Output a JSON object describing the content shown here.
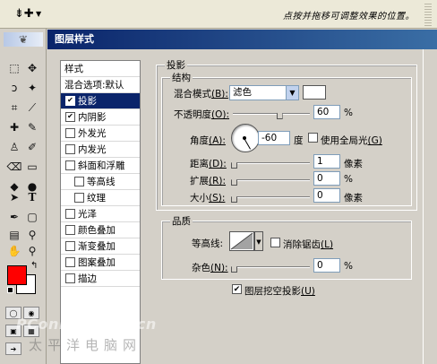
{
  "options_bar": {
    "hint": "点按并拖移可调整效果的位置。",
    "tool_icon": "move-tool-icon",
    "preset_arrow": "▼"
  },
  "dialog": {
    "title": "图层样式"
  },
  "style_list": {
    "header": "样式",
    "blend_default": "混合选项:默认",
    "items": [
      {
        "label": "投影",
        "checked": true,
        "selected": true
      },
      {
        "label": "内阴影",
        "checked": true,
        "selected": false
      },
      {
        "label": "外发光",
        "checked": false,
        "selected": false
      },
      {
        "label": "内发光",
        "checked": false,
        "selected": false
      },
      {
        "label": "斜面和浮雕",
        "checked": false,
        "selected": false
      },
      {
        "label": "等高线",
        "checked": false,
        "selected": false
      },
      {
        "label": "纹理",
        "checked": false,
        "selected": false
      },
      {
        "label": "光泽",
        "checked": false,
        "selected": false
      },
      {
        "label": "颜色叠加",
        "checked": false,
        "selected": false
      },
      {
        "label": "渐变叠加",
        "checked": false,
        "selected": false
      },
      {
        "label": "图案叠加",
        "checked": false,
        "selected": false
      },
      {
        "label": "描边",
        "checked": false,
        "selected": false
      }
    ]
  },
  "drop_shadow": {
    "section_title": "投影",
    "structure": {
      "title": "结构",
      "blend_mode_label": "混合模式",
      "blend_mode_key": "(B):",
      "blend_mode_value": "滤色",
      "shadow_color": "#ffffff",
      "opacity_label": "不透明度",
      "opacity_key": "(O):",
      "opacity_value": "60",
      "opacity_unit": "%",
      "opacity_level": 0.6,
      "angle_label": "角度",
      "angle_key": "(A):",
      "angle_value": "-60",
      "angle_unit": "度",
      "global_light_label": "使用全局光",
      "global_light_key": "(G)",
      "global_light_checked": false,
      "distance_label": "距离",
      "distance_key": "(D):",
      "distance_value": "1",
      "distance_unit": "像素",
      "spread_label": "扩展",
      "spread_key": "(R):",
      "spread_value": "0",
      "spread_unit": "%",
      "size_label": "大小",
      "size_key": "(S):",
      "size_value": "0",
      "size_unit": "像素"
    },
    "quality": {
      "title": "品质",
      "contour_label": "等高线:",
      "antialias_label": "消除锯齿",
      "antialias_key": "(L)",
      "antialias_checked": false,
      "noise_label": "杂色",
      "noise_key": "(N):",
      "noise_value": "0",
      "noise_unit": "%"
    },
    "knockout_label": "图层挖空投影",
    "knockout_key": "(U)",
    "knockout_checked": true
  },
  "toolbox": {
    "foreground_color": "#ff0000",
    "background_color": "#ffffff",
    "tools": [
      "marquee-icon",
      "move-icon",
      "lasso-icon",
      "magic-wand-icon",
      "crop-icon",
      "slice-icon",
      "healing-icon",
      "brush-icon",
      "stamp-icon",
      "history-brush-icon",
      "eraser-icon",
      "gradient-icon",
      "blur-icon",
      "dodge-icon",
      "path-select-icon",
      "type-icon",
      "pen-icon",
      "shape-icon",
      "notes-icon",
      "eyedropper-icon",
      "hand-icon",
      "zoom-icon"
    ]
  },
  "watermark": {
    "line1": "PConline.com.cn",
    "line2": "太平洋电脑网"
  }
}
